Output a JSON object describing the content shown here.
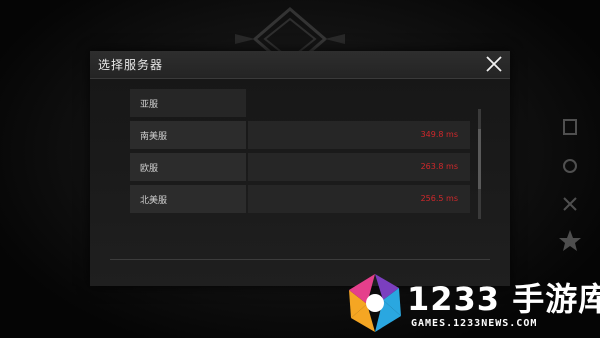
{
  "background": {
    "top_text": "",
    "top_sub": ""
  },
  "dialog": {
    "title": "选择服务器",
    "close_icon": "close-icon",
    "servers": [
      {
        "name": "亚服",
        "ping": ""
      },
      {
        "name": "南美服",
        "ping": "349.8 ms"
      },
      {
        "name": "欧服",
        "ping": "263.8 ms"
      },
      {
        "name": "北美服",
        "ping": "256.5 ms"
      }
    ]
  },
  "watermark": {
    "title": "1233 手游库",
    "subtitle": "GAMES.1233NEWS.COM"
  },
  "colors": {
    "ping": "#d0282b",
    "logo_orange": "#f5a623",
    "logo_blue": "#2aa7e0",
    "logo_purple": "#7b3fbf"
  }
}
